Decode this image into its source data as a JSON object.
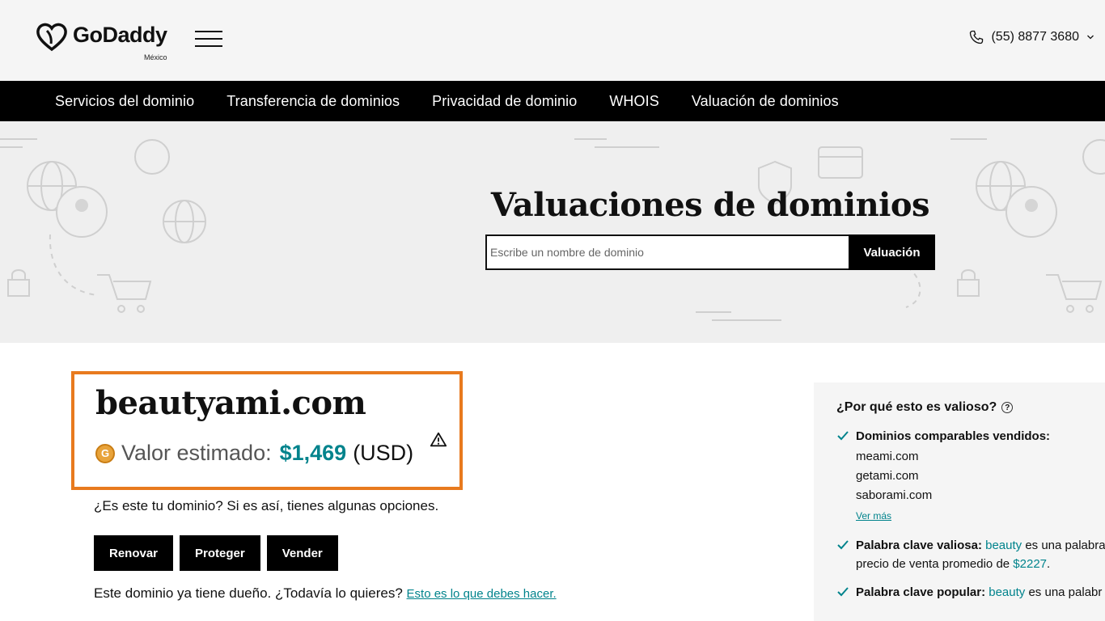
{
  "header": {
    "brand": "GoDaddy",
    "region": "México",
    "phone": "(55) 8877 3680"
  },
  "nav": {
    "items": [
      "Servicios del dominio",
      "Transferencia de dominios",
      "Privacidad de dominio",
      "WHOIS",
      "Valuación de dominios"
    ]
  },
  "hero": {
    "title": "Valuaciones de dominios",
    "search_placeholder": "Escribe un nombre de dominio",
    "search_button": "Valuación"
  },
  "result": {
    "domain": "beautyami.com",
    "value_label": "Valor estimado:",
    "value_amount": "$1,469",
    "value_currency": "(USD)",
    "coin_letter": "G",
    "owner_question": "¿Es este tu dominio? Si es así, tienes algunas opciones.",
    "buttons": [
      "Renovar",
      "Proteger",
      "Vender"
    ],
    "owned_text": "Este dominio ya tiene dueño. ¿Todavía lo quieres?",
    "owned_link": "Esto es lo que debes hacer."
  },
  "panel": {
    "title": "¿Por qué esto es valioso?",
    "help": "?",
    "comparables_title": "Dominios comparables vendidos:",
    "comparables": [
      "meami.com",
      "getami.com",
      "saborami.com"
    ],
    "ver_mas": "Ver más",
    "keyword_valuable": {
      "label": "Palabra clave valiosa:",
      "keyword": "beauty",
      "text": "es una palabra",
      "line2_prefix": "precio de venta promedio de",
      "price": "$2227",
      "line2_suffix": "."
    },
    "keyword_popular": {
      "label": "Palabra clave popular:",
      "keyword": "beauty",
      "text": "es una palabr"
    }
  },
  "colors": {
    "accent": "#00838c",
    "highlight_border": "#e87a1e",
    "nav_bg": "#000000"
  }
}
